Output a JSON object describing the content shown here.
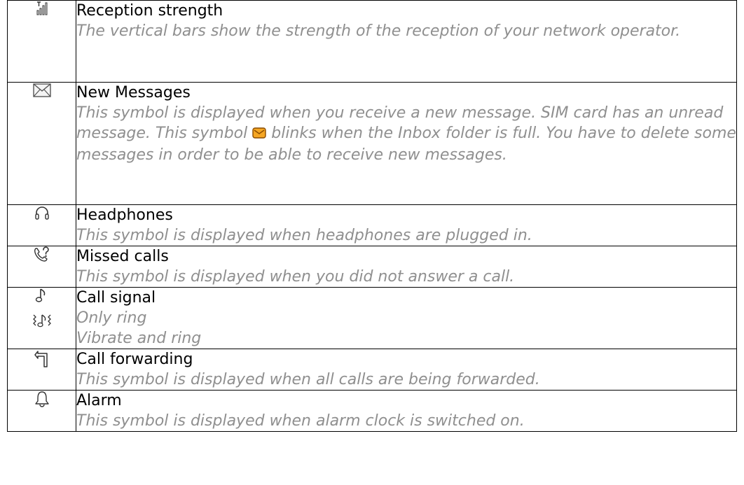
{
  "rows": [
    {
      "icon": "signal-strength-icon",
      "title": "Reception strength",
      "desc": "The vertical bars show the strength of the reception of your network operator."
    },
    {
      "icon": "envelope-icon",
      "title": "New Messages",
      "desc_before": "This symbol is displayed when you receive a new message. SIM card has an unread message. This symbol ",
      "inline_icon": "orange-envelope-icon",
      "desc_after": " blinks when the Inbox folder is full. You have to delete some messages in order to be able to receive new messages."
    },
    {
      "icon": "headphones-icon",
      "title": "Headphones",
      "desc": "This symbol is displayed when headphones are plugged in."
    },
    {
      "icon": "missed-call-icon",
      "title": "Missed calls",
      "desc": "This symbol is displayed when you did not answer a call."
    },
    {
      "icons": [
        "music-note-icon",
        "vibrate-ring-icon"
      ],
      "title": "Call signal",
      "lines": [
        "Only ring",
        "Vibrate and ring"
      ]
    },
    {
      "icon": "call-forward-icon",
      "title": "Call forwarding",
      "desc": "This symbol is displayed when all calls are being forwarded."
    },
    {
      "icon": "bell-icon",
      "title": "Alarm",
      "desc": "This symbol is displayed when alarm clock is switched on."
    }
  ]
}
